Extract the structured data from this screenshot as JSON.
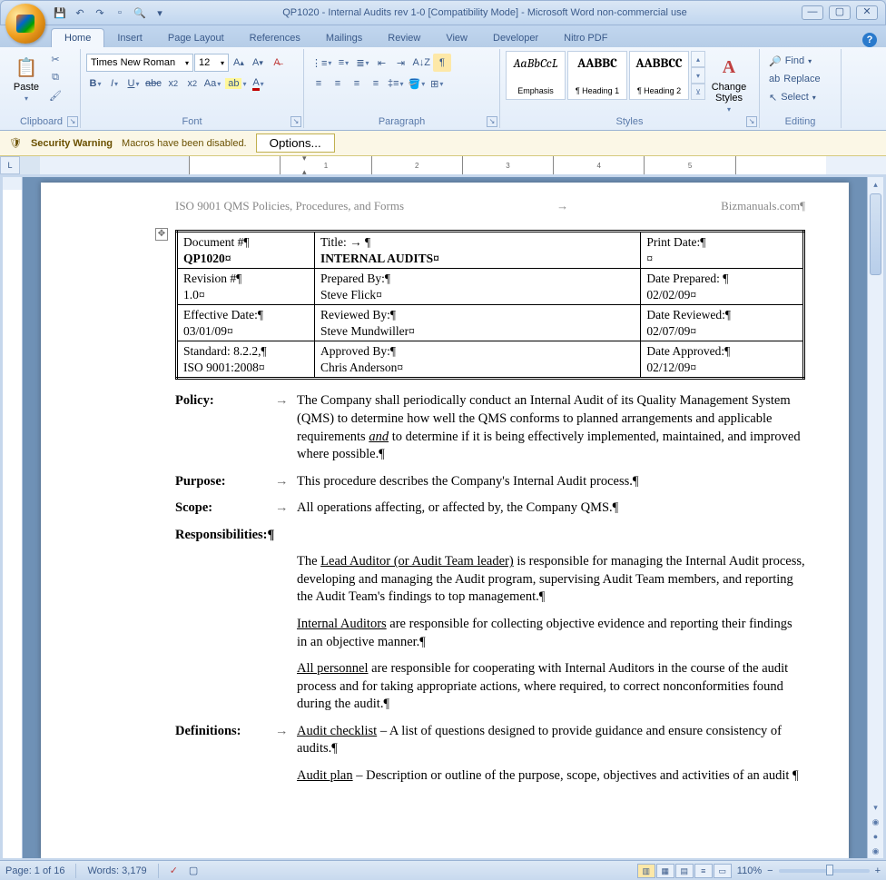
{
  "window": {
    "title": "QP1020 - Internal Audits rev 1-0 [Compatibility Mode] - Microsoft Word non-commercial use"
  },
  "tabs": [
    "Home",
    "Insert",
    "Page Layout",
    "References",
    "Mailings",
    "Review",
    "View",
    "Developer",
    "Nitro PDF"
  ],
  "ribbon": {
    "clipboard": {
      "label": "Clipboard",
      "paste": "Paste"
    },
    "font": {
      "label": "Font",
      "name": "Times New Roman",
      "size": "12"
    },
    "paragraph": {
      "label": "Paragraph"
    },
    "styles": {
      "label": "Styles",
      "changeStyles": "Change Styles",
      "items": [
        {
          "preview": "AaBbCcL",
          "name": "Emphasis"
        },
        {
          "preview": "AABBC",
          "name": "¶ Heading 1"
        },
        {
          "preview": "AABBCC",
          "name": "¶ Heading 2"
        }
      ]
    },
    "editing": {
      "label": "Editing",
      "find": "Find",
      "replace": "Replace",
      "select": "Select"
    }
  },
  "security": {
    "warning": "Security Warning",
    "message": "Macros have been disabled.",
    "options": "Options..."
  },
  "doc": {
    "header_left": "ISO 9001 QMS Policies, Procedures, and Forms",
    "header_right": "Bizmanuals.com¶",
    "table": {
      "r1": {
        "a1": "Document #¶",
        "a2": "QP1020¤",
        "b1": "Title: → ¶",
        "b2": "INTERNAL AUDITS¤",
        "c1": "Print Date:¶",
        "c2": "¤"
      },
      "r2": {
        "a1": "Revision #¶",
        "a2": "1.0¤",
        "b1": "Prepared By:¶",
        "b2": "Steve Flick¤",
        "c1": "Date Prepared: ¶",
        "c2": "02/02/09¤"
      },
      "r3": {
        "a1": "Effective Date:¶",
        "a2": "03/01/09¤",
        "b1": "Reviewed By:¶",
        "b2": "Steve Mundwiller¤",
        "c1": "Date Reviewed:¶",
        "c2": "02/07/09¤"
      },
      "r4": {
        "a1": "Standard: 8.2.2,¶",
        "a2": "ISO 9001:2008¤",
        "b1": "Approved By:¶",
        "b2": "Chris Anderson¤",
        "c1": "Date Approved:¶",
        "c2": "02/12/09¤"
      }
    },
    "policy_label": "Policy:",
    "policy": "The Company shall periodically conduct an Internal Audit of its Quality Management System (QMS) to determine how well the QMS conforms to planned arrangements and applicable requirements ",
    "policy_and": "and",
    "policy2": " to determine if it is being effectively implemented, maintained, and improved where possible.¶",
    "purpose_label": "Purpose:",
    "purpose": "This procedure describes the Company's Internal Audit process.¶",
    "scope_label": "Scope:",
    "scope": "All operations affecting, or affected by, the Company QMS.¶",
    "resp_label": "Responsibilities:¶",
    "resp1_u": "Lead Auditor (or Audit Team leader)",
    "resp1": " is responsible for managing the Internal Audit process, developing and managing the Audit program, supervising Audit Team members, and reporting the Audit Team's findings to top management.¶",
    "resp2_u": "Internal Auditors",
    "resp2": " are responsible for collecting objective evidence and reporting their findings in an objective manner.¶",
    "resp3_u": "All personnel",
    "resp3": " are responsible for cooperating with Internal Auditors in the course of the audit process and for taking appropriate actions, where required, to correct nonconformities found during the audit.¶",
    "def_label": "Definitions:",
    "def1_u": "Audit checklist",
    "def1": " – A list of questions designed to provide guidance and ensure consistency of audits.¶",
    "def2_u": "Audit plan",
    "def2": " – Description or outline of the purpose, scope, objectives and activities of an audit ¶"
  },
  "status": {
    "page": "Page: 1 of 16",
    "words": "Words: 3,179",
    "zoom": "110%"
  }
}
